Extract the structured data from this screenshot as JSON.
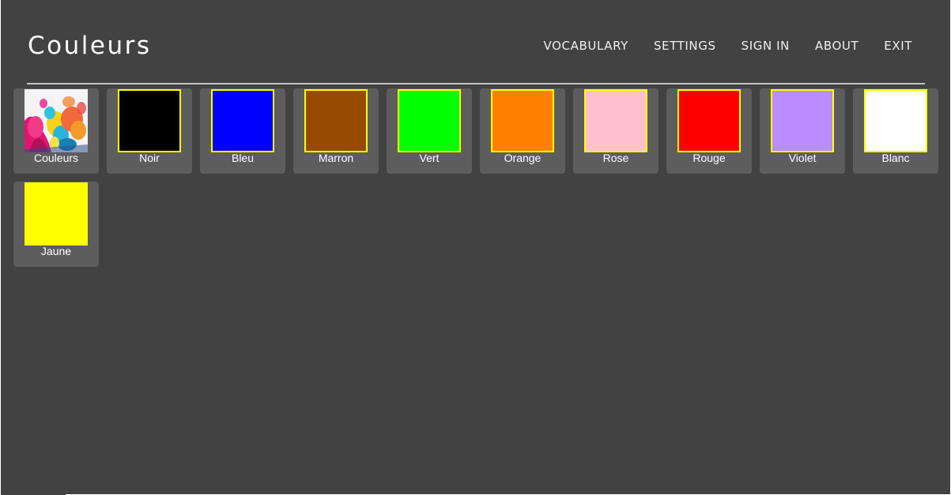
{
  "header": {
    "title": "Couleurs",
    "nav": [
      "VOCABULARY",
      "SETTINGS",
      "SIGN IN",
      "ABOUT",
      "EXIT"
    ]
  },
  "tiles": [
    {
      "label": "Couleurs",
      "kind": "image",
      "icon": "paint-splash-image"
    },
    {
      "label": "Noir",
      "color": "#000000"
    },
    {
      "label": "Bleu",
      "color": "#0000ff"
    },
    {
      "label": "Marron",
      "color": "#964b00"
    },
    {
      "label": "Vert",
      "color": "#00ff00"
    },
    {
      "label": "Orange",
      "color": "#ff8000"
    },
    {
      "label": "Rose",
      "color": "#ffc0cb"
    },
    {
      "label": "Rouge",
      "color": "#ff0000"
    },
    {
      "label": "Violet",
      "color": "#b98cff"
    },
    {
      "label": "Blanc",
      "color": "#ffffff"
    },
    {
      "label": "Jaune",
      "color": "#ffff00",
      "border": false
    }
  ],
  "theme": {
    "background": "#424242",
    "tile": "#5d5d5d",
    "swatch_border": "#ffff00",
    "divider": "#c4c4c4"
  }
}
